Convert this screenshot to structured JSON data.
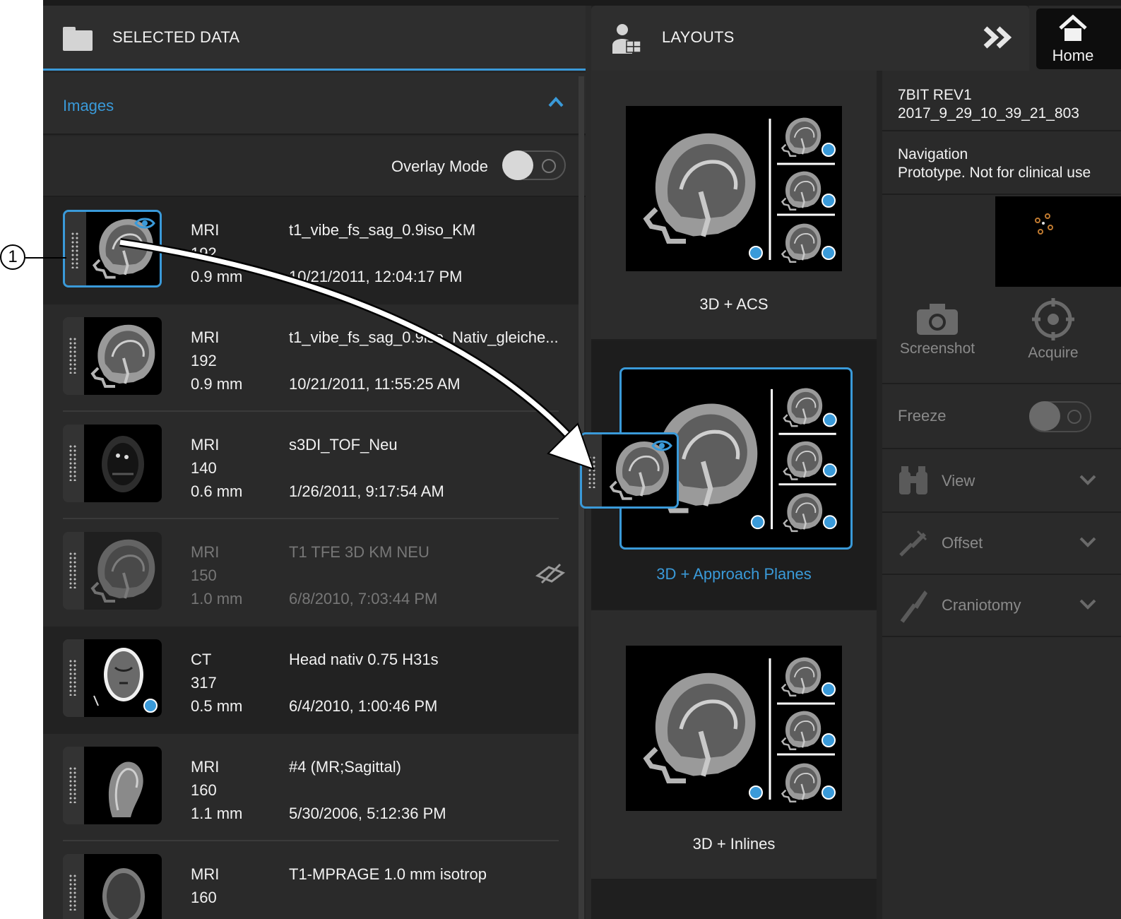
{
  "callout": "1",
  "selected_data": {
    "title": "SELECTED DATA",
    "images_label": "Images",
    "overlay_label": "Overlay Mode",
    "rows": [
      {
        "modality": "MRI",
        "count": "192",
        "slice": "0.9 mm",
        "name": "t1_vibe_fs_sag_0.9iso_KM",
        "date": "10/21/2011, 12:04:17 PM"
      },
      {
        "modality": "MRI",
        "count": "192",
        "slice": "0.9 mm",
        "name": "t1_vibe_fs_sag_0.9iso_Nativ_gleiche...",
        "date": "10/21/2011, 11:55:25 AM"
      },
      {
        "modality": "MRI",
        "count": "140",
        "slice": "0.6 mm",
        "name": "s3DI_TOF_Neu",
        "date": "1/26/2011, 9:17:54 AM"
      },
      {
        "modality": "MRI",
        "count": "150",
        "slice": "1.0 mm",
        "name": "T1 TFE 3D KM NEU",
        "date": "6/8/2010, 7:03:44 PM"
      },
      {
        "modality": "CT",
        "count": "317",
        "slice": "0.5 mm",
        "name": "Head nativ 0.75 H31s",
        "date": "6/4/2010, 1:00:46 PM"
      },
      {
        "modality": "MRI",
        "count": "160",
        "slice": "1.1 mm",
        "name": "#4 (MR;Sagittal)",
        "date": "5/30/2006, 5:12:36 PM"
      },
      {
        "modality": "MRI",
        "count": "160",
        "slice": "",
        "name": "T1-MPRAGE 1.0 mm isotrop",
        "date": ""
      }
    ]
  },
  "layouts": {
    "title": "LAYOUTS",
    "items": [
      {
        "label": "3D + ACS"
      },
      {
        "label": "3D + Approach Planes"
      },
      {
        "label": "3D + Inlines"
      }
    ]
  },
  "home": {
    "label": "Home"
  },
  "info": {
    "device_line1": "7BIT REV1",
    "device_line2": "2017_9_29_10_39_21_803",
    "nav_line1": "Navigation",
    "nav_line2": "Prototype. Not for clinical use"
  },
  "tools": {
    "screenshot": "Screenshot",
    "acquire": "Acquire",
    "freeze": "Freeze"
  },
  "accordion": {
    "view": "View",
    "offset": "Offset",
    "craniotomy": "Craniotomy"
  },
  "colors": {
    "accent": "#3a9ad9",
    "panel": "#2a2a2a",
    "text": "#f2f2f2",
    "disabled": "#8a8a8a"
  }
}
